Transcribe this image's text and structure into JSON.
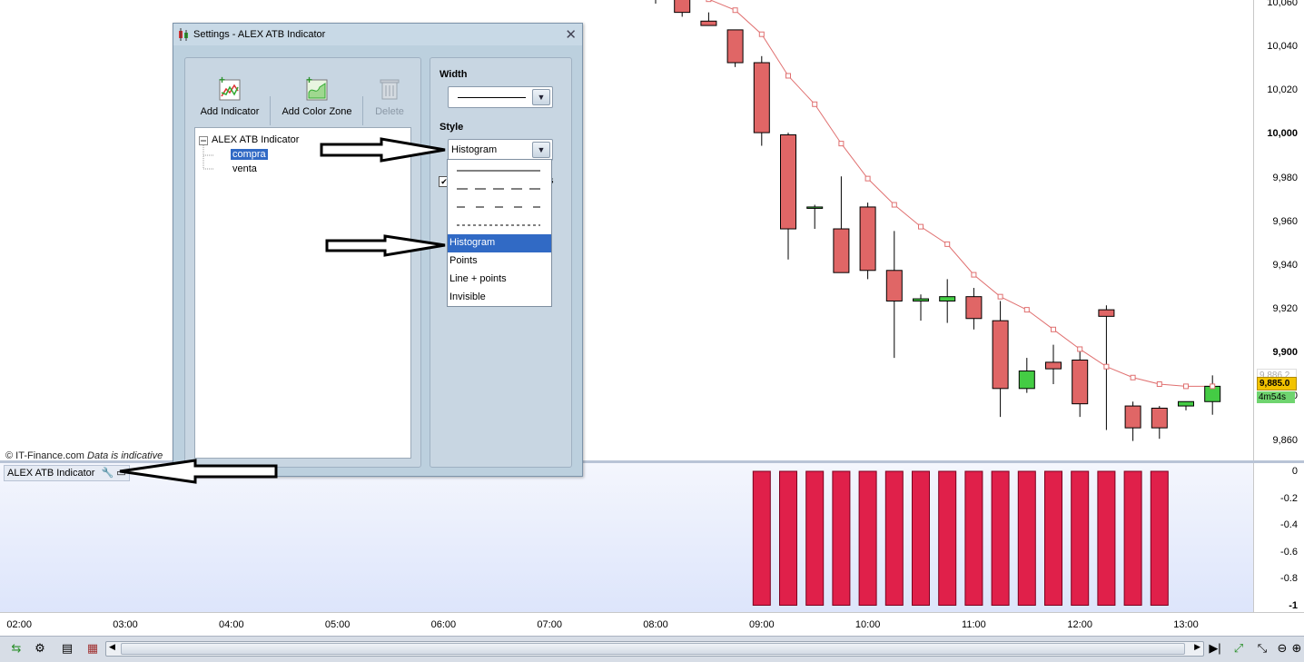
{
  "colors": {
    "bear": "#e06666",
    "bull": "#44cc44",
    "ma_line": "#e07070",
    "histogram": "#e0204a",
    "selection": "#316ac5"
  },
  "price_axis": {
    "labels": [
      "10,060",
      "10,040",
      "10,020",
      "10,000",
      "9,980",
      "9,960",
      "9,940",
      "9,920",
      "9,900",
      "9,880",
      "9,860"
    ],
    "bold_labels": [
      "10,000",
      "9,900"
    ],
    "current_price": "9,885.0",
    "ghost_price": "9,886.2",
    "countdown": "4m54s"
  },
  "sub_axis": {
    "labels": [
      "0",
      "-0.2",
      "-0.4",
      "-0.6",
      "-0.8",
      "-1"
    ]
  },
  "time_axis": {
    "labels": [
      "02:00",
      "03:00",
      "04:00",
      "05:00",
      "06:00",
      "07:00",
      "08:00",
      "09:00",
      "10:00",
      "11:00",
      "12:00",
      "13:00"
    ]
  },
  "chart_data": {
    "type": "candlestick",
    "x": [
      "08:00",
      "08:15",
      "08:30",
      "08:45",
      "09:00",
      "09:15",
      "09:30",
      "09:45",
      "10:00",
      "10:15",
      "10:30",
      "10:45",
      "11:00",
      "11:15",
      "11:30",
      "11:45",
      "12:00",
      "12:15",
      "12:30",
      "12:45",
      "13:00",
      "13:15"
    ],
    "open": [
      10066,
      10062,
      10052,
      10048,
      10033,
      10000,
      9967,
      9957,
      9967,
      9938,
      9924,
      9924,
      9926,
      9915,
      9884,
      9896,
      9897,
      9920,
      9876,
      9875,
      9876,
      9878
    ],
    "high": [
      10068,
      10064,
      10056,
      10048,
      10036,
      10001,
      9968,
      9981,
      9969,
      9956,
      9927,
      9934,
      9930,
      9924,
      9898,
      9904,
      9902,
      9922,
      9878,
      9876,
      9878,
      9890
    ],
    "low": [
      10060,
      10054,
      10052,
      10031,
      9995,
      9943,
      9957,
      9946,
      9934,
      9898,
      9915,
      9914,
      9911,
      9871,
      9882,
      9886,
      9871,
      9865,
      9860,
      9861,
      9874,
      9872
    ],
    "close": [
      10068,
      10056,
      10050,
      10033,
      10001,
      9957,
      9967,
      9937,
      9938,
      9924,
      9925,
      9926,
      9916,
      9884,
      9892,
      9893,
      9877,
      9917,
      9866,
      9866,
      9878,
      9885
    ],
    "ma": [
      10070,
      10062,
      10057,
      10046,
      10027,
      10014,
      9996,
      9980,
      9968,
      9958,
      9950,
      9936,
      9926,
      9920,
      9911,
      9902,
      9894,
      9889,
      9886,
      9885,
      9885
    ],
    "ma_x_start": 1,
    "ylim": [
      9855,
      10062
    ],
    "indicator": {
      "name": "ALEX ATB Indicator",
      "type": "histogram",
      "values": [
        -1,
        -1,
        -1,
        -1,
        -1,
        -1,
        -1,
        -1,
        -1,
        -1,
        -1,
        -1,
        -1,
        -1,
        -1,
        -1
      ],
      "x_start": "09:00",
      "ylim": [
        -1.03,
        0.05
      ]
    }
  },
  "overlay": {
    "copyright": "© IT-Finance.com",
    "disclaimer": "Data is indicative",
    "indicator_label": "ALEX ATB Indicator"
  },
  "dialog": {
    "title": "Settings - ALEX ATB Indicator",
    "toolbar": {
      "add_indicator": "Add Indicator",
      "add_color_zone": "Add Color Zone",
      "delete": "Delete"
    },
    "tree": {
      "root": "ALEX ATB Indicator",
      "children": [
        "compra",
        "venta"
      ],
      "selected": "compra"
    },
    "width_label": "Width",
    "style_label": "Style",
    "style_value": "Histogram",
    "style_options": [
      "Histogram",
      "Points",
      "Line + points",
      "Invisible"
    ],
    "checkbox_suffix": "xis"
  }
}
